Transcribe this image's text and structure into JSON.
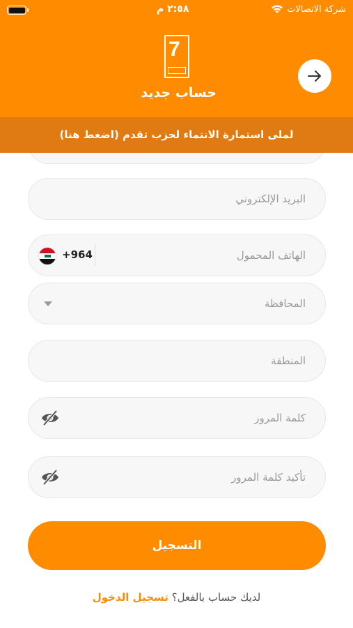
{
  "status_bar": {
    "carrier": "شركة الاتصالات",
    "time": "٢:٥٨ م"
  },
  "header": {
    "title": "حساب جديد",
    "back_icon": "arrow-right-icon",
    "logo_icon": "party-logo-icon"
  },
  "banner": {
    "text": "لملى استمارة الانتماء لحزب تقدم (اضغط هنا)"
  },
  "form": {
    "email_placeholder": "البريد الإلكتروني",
    "phone_placeholder": "الهاتف المحمول",
    "country_code": "+964",
    "governorate_placeholder": "المحافظة",
    "region_placeholder": "المنطقة",
    "password_placeholder": "كلمة المرور",
    "confirm_password_placeholder": "تأكيد كلمة المرور"
  },
  "actions": {
    "register_label": "التسجيل",
    "have_account_text": "لديك حساب بالفعل؟",
    "login_label": "تسجيل الدخول"
  },
  "colors": {
    "primary": "#ff8c00",
    "banner": "#e07a12",
    "field_bg": "#f7f7f7"
  }
}
